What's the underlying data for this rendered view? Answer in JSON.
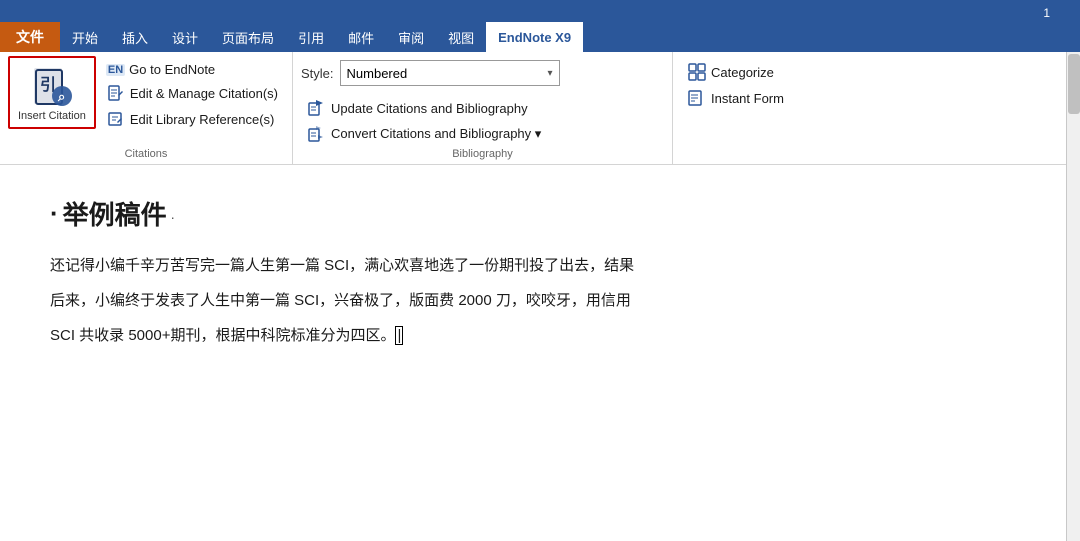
{
  "titlebar": {
    "page_num": "1"
  },
  "menubar": {
    "tabs": [
      {
        "label": "文件",
        "type": "file"
      },
      {
        "label": "开始",
        "type": "normal"
      },
      {
        "label": "插入",
        "type": "normal"
      },
      {
        "label": "设计",
        "type": "normal"
      },
      {
        "label": "页面布局",
        "type": "normal"
      },
      {
        "label": "引用",
        "type": "normal"
      },
      {
        "label": "邮件",
        "type": "normal"
      },
      {
        "label": "审阅",
        "type": "normal"
      },
      {
        "label": "视图",
        "type": "normal"
      },
      {
        "label": "EndNote X9",
        "type": "active"
      }
    ]
  },
  "ribbon": {
    "citations_group_label": "Citations",
    "bibliography_group_label": "Bibliography",
    "insert_citation_label": "Insert\nCitation",
    "items": [
      {
        "icon": "EN",
        "label": "Go to EndNote",
        "type": "en"
      },
      {
        "icon": "🔧",
        "label": "Edit & Manage Citation(s)",
        "type": "icon"
      },
      {
        "icon": "📚",
        "label": "Edit Library Reference(s)",
        "type": "icon"
      }
    ],
    "style_label": "Style:",
    "style_value": "Numbered",
    "bib_items": [
      {
        "icon": "🔄",
        "label": "Update Citations and Bibliography"
      },
      {
        "icon": "🔀",
        "label": "Convert Citations and Bibliography ▾"
      }
    ],
    "right_items": [
      {
        "label": "Categorize"
      },
      {
        "label": "Instant Form"
      }
    ]
  },
  "document": {
    "heading": "·举例稿件",
    "paragraphs": [
      "还记得小编千辛万苦写完一篇人生第一篇 SCI，满心欢喜地选了一份期刊投了出去，结果",
      "后来，小编终于发表了人生中第一篇 SCI，兴奋极了，版面费 2000 刀，咬咬牙，用信用",
      "SCI 共收录 5000+期刊，根据中科院标准分为四区。"
    ]
  }
}
